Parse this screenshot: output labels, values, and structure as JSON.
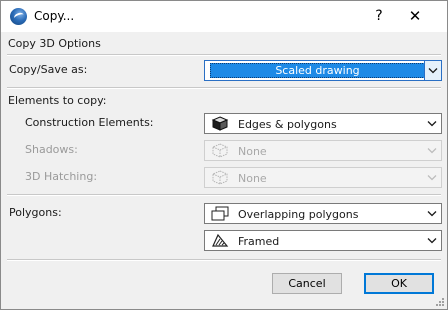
{
  "window": {
    "title": "Copy...",
    "help_glyph": "?",
    "close_glyph": "✕",
    "app_icon": "archicad-icon"
  },
  "section_header": "Copy 3D Options",
  "copy_save": {
    "label": "Copy/Save as:",
    "value": "Scaled drawing",
    "focused": true
  },
  "elements": {
    "heading": "Elements to copy:",
    "construction": {
      "label": "Construction Elements:",
      "value": "Edges & polygons",
      "icon": "solid-cube-icon",
      "enabled": true
    },
    "shadows": {
      "label": "Shadows:",
      "value": "None",
      "icon": "wireframe-cube-icon",
      "enabled": false
    },
    "hatching": {
      "label": "3D Hatching:",
      "value": "None",
      "icon": "wireframe-cube-icon",
      "enabled": false
    }
  },
  "polygons": {
    "label": "Polygons:",
    "mode": {
      "value": "Overlapping polygons",
      "icon": "overlapping-polygons-icon"
    },
    "frame": {
      "value": "Framed",
      "icon": "framed-hatch-icon"
    }
  },
  "buttons": {
    "cancel": "Cancel",
    "ok": "OK"
  },
  "colors": {
    "selection_blue": "#1e8ae6",
    "focus_border": "#2a6fc4",
    "default_button_border": "#0078d7"
  }
}
